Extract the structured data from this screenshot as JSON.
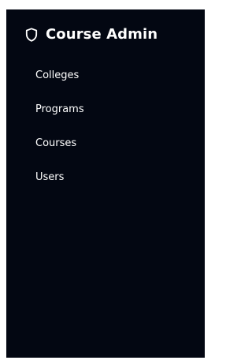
{
  "sidebar": {
    "brand": {
      "icon": "shield-icon",
      "title": "Course Admin"
    },
    "items": [
      {
        "label": "Colleges"
      },
      {
        "label": "Programs"
      },
      {
        "label": "Courses"
      },
      {
        "label": "Users"
      }
    ]
  },
  "colors": {
    "sidebar_background": "#030712",
    "text": "#ffffff",
    "page_background": "#ffffff"
  }
}
